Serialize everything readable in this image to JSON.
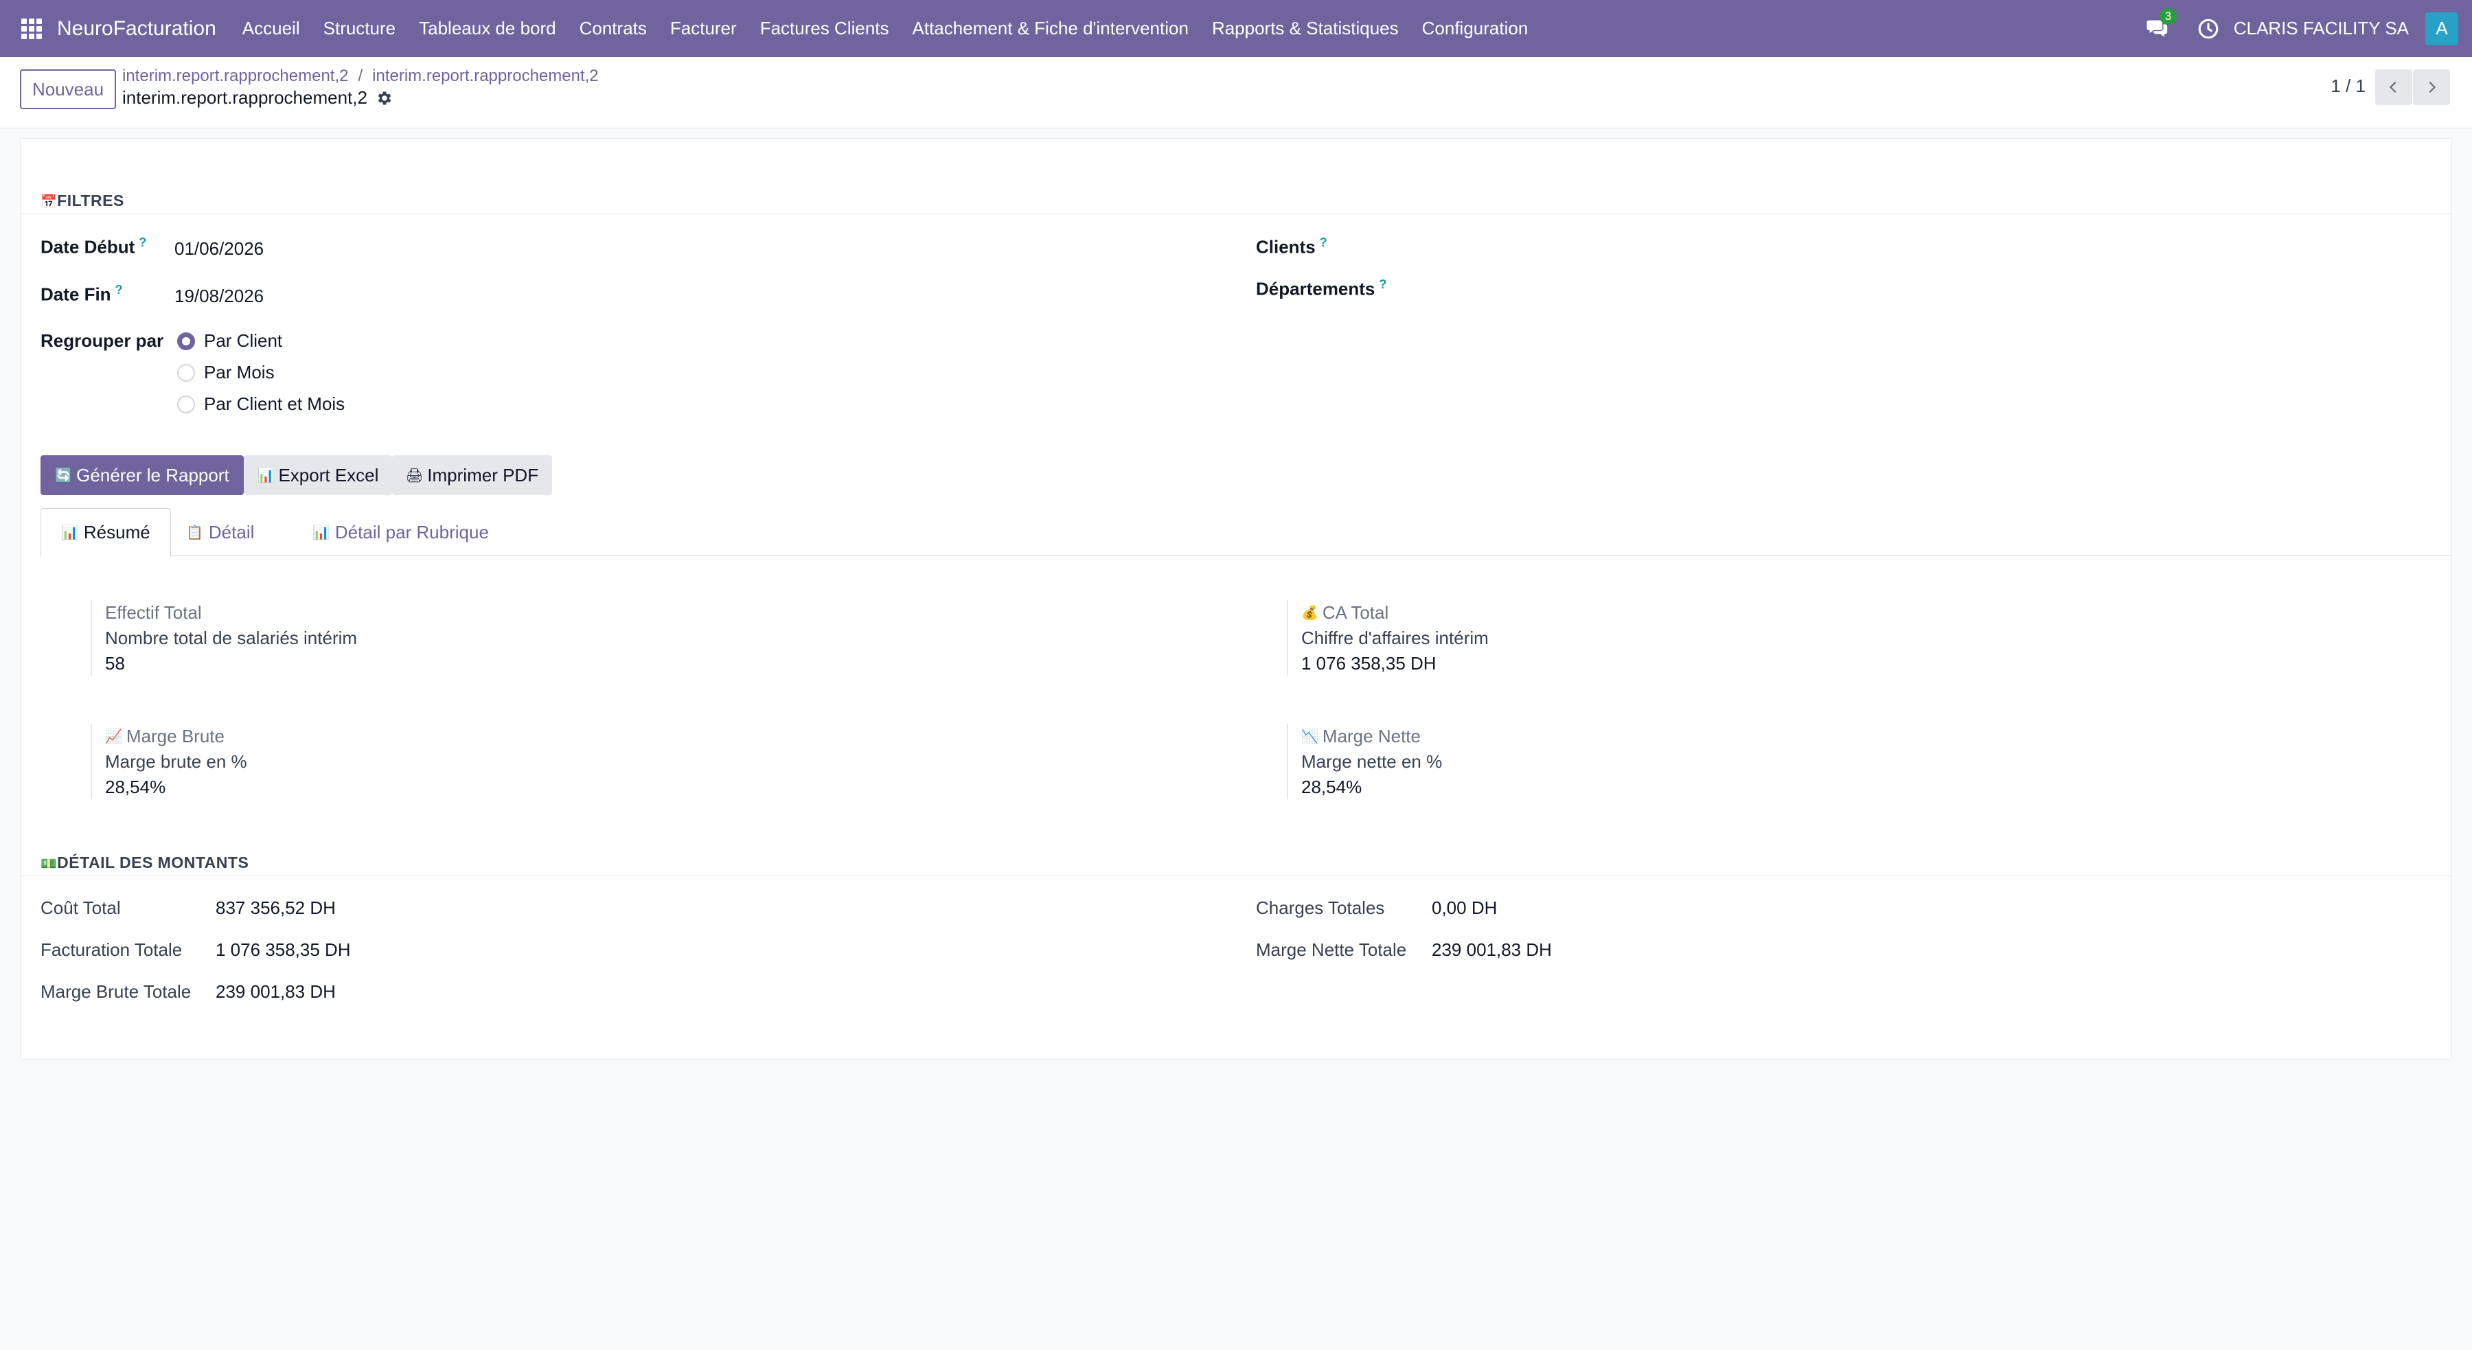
{
  "navbar": {
    "brand": "NeuroFacturation",
    "menu": [
      "Accueil",
      "Structure",
      "Tableaux de bord",
      "Contrats",
      "Facturer",
      "Factures Clients",
      "Attachement & Fiche d'intervention",
      "Rapports & Statistiques",
      "Configuration"
    ],
    "messages_badge": "3",
    "company": "CLARIS FACILITY SA",
    "avatar_letter": "A"
  },
  "control": {
    "new_button": "Nouveau",
    "breadcrumbs": [
      "interim.report.rapprochement,2",
      "interim.report.rapprochement,2"
    ],
    "breadcrumb_separator": "/",
    "record_title": "interim.report.rapprochement,2",
    "pager": "1 / 1"
  },
  "filters": {
    "section_title": "FILTRES",
    "section_icon": "📅",
    "date_start_label": "Date Début",
    "date_start_value": "01/06/2026",
    "date_end_label": "Date Fin",
    "date_end_value": "19/08/2026",
    "clients_label": "Clients",
    "departments_label": "Départements",
    "help_mark": "?",
    "group_by_label": "Regrouper par",
    "group_by_options": [
      "Par Client",
      "Par Mois",
      "Par Client et Mois"
    ],
    "group_by_selected": "Par Client"
  },
  "actions": {
    "generate": {
      "icon": "🔄",
      "label": "Générer le Rapport"
    },
    "export_excel": {
      "icon": "📊",
      "label": "Export Excel"
    },
    "print_pdf": {
      "icon": "🖨",
      "label": "Imprimer PDF"
    }
  },
  "tabs": [
    {
      "icon": "📊",
      "label": "Résumé",
      "active": true
    },
    {
      "icon": "📋",
      "label": "Détail",
      "active": false
    },
    {
      "icon": "📊",
      "label": "Détail par Rubrique",
      "active": false
    }
  ],
  "stats": [
    {
      "icon": "",
      "title": "Effectif Total",
      "desc": "Nombre total de salariés intérim",
      "value": "58"
    },
    {
      "icon": "💰",
      "title": "CA Total",
      "desc": "Chiffre d'affaires intérim",
      "value": "1 076 358,35 DH"
    },
    {
      "icon": "📈",
      "title": "Marge Brute",
      "desc": "Marge brute en %",
      "value": "28,54%"
    },
    {
      "icon": "📉",
      "title": "Marge Nette",
      "desc": "Marge nette en %",
      "value": "28,54%"
    }
  ],
  "amounts": {
    "section_title": "DÉTAIL DES MONTANTS",
    "section_icon": "💵",
    "left": [
      {
        "label": "Coût Total",
        "value": "837 356,52 DH"
      },
      {
        "label": "Facturation Totale",
        "value": "1 076 358,35 DH"
      },
      {
        "label": "Marge Brute Totale",
        "value": "239 001,83 DH"
      }
    ],
    "right": [
      {
        "label": "Charges Totales",
        "value": "0,00 DH"
      },
      {
        "label": "Marge Nette Totale",
        "value": "239 001,83 DH"
      }
    ]
  },
  "colors": {
    "brand": "#71639e",
    "badge": "#2a9d3f",
    "avatar": "#27a2c6",
    "help": "#0f9da4"
  }
}
